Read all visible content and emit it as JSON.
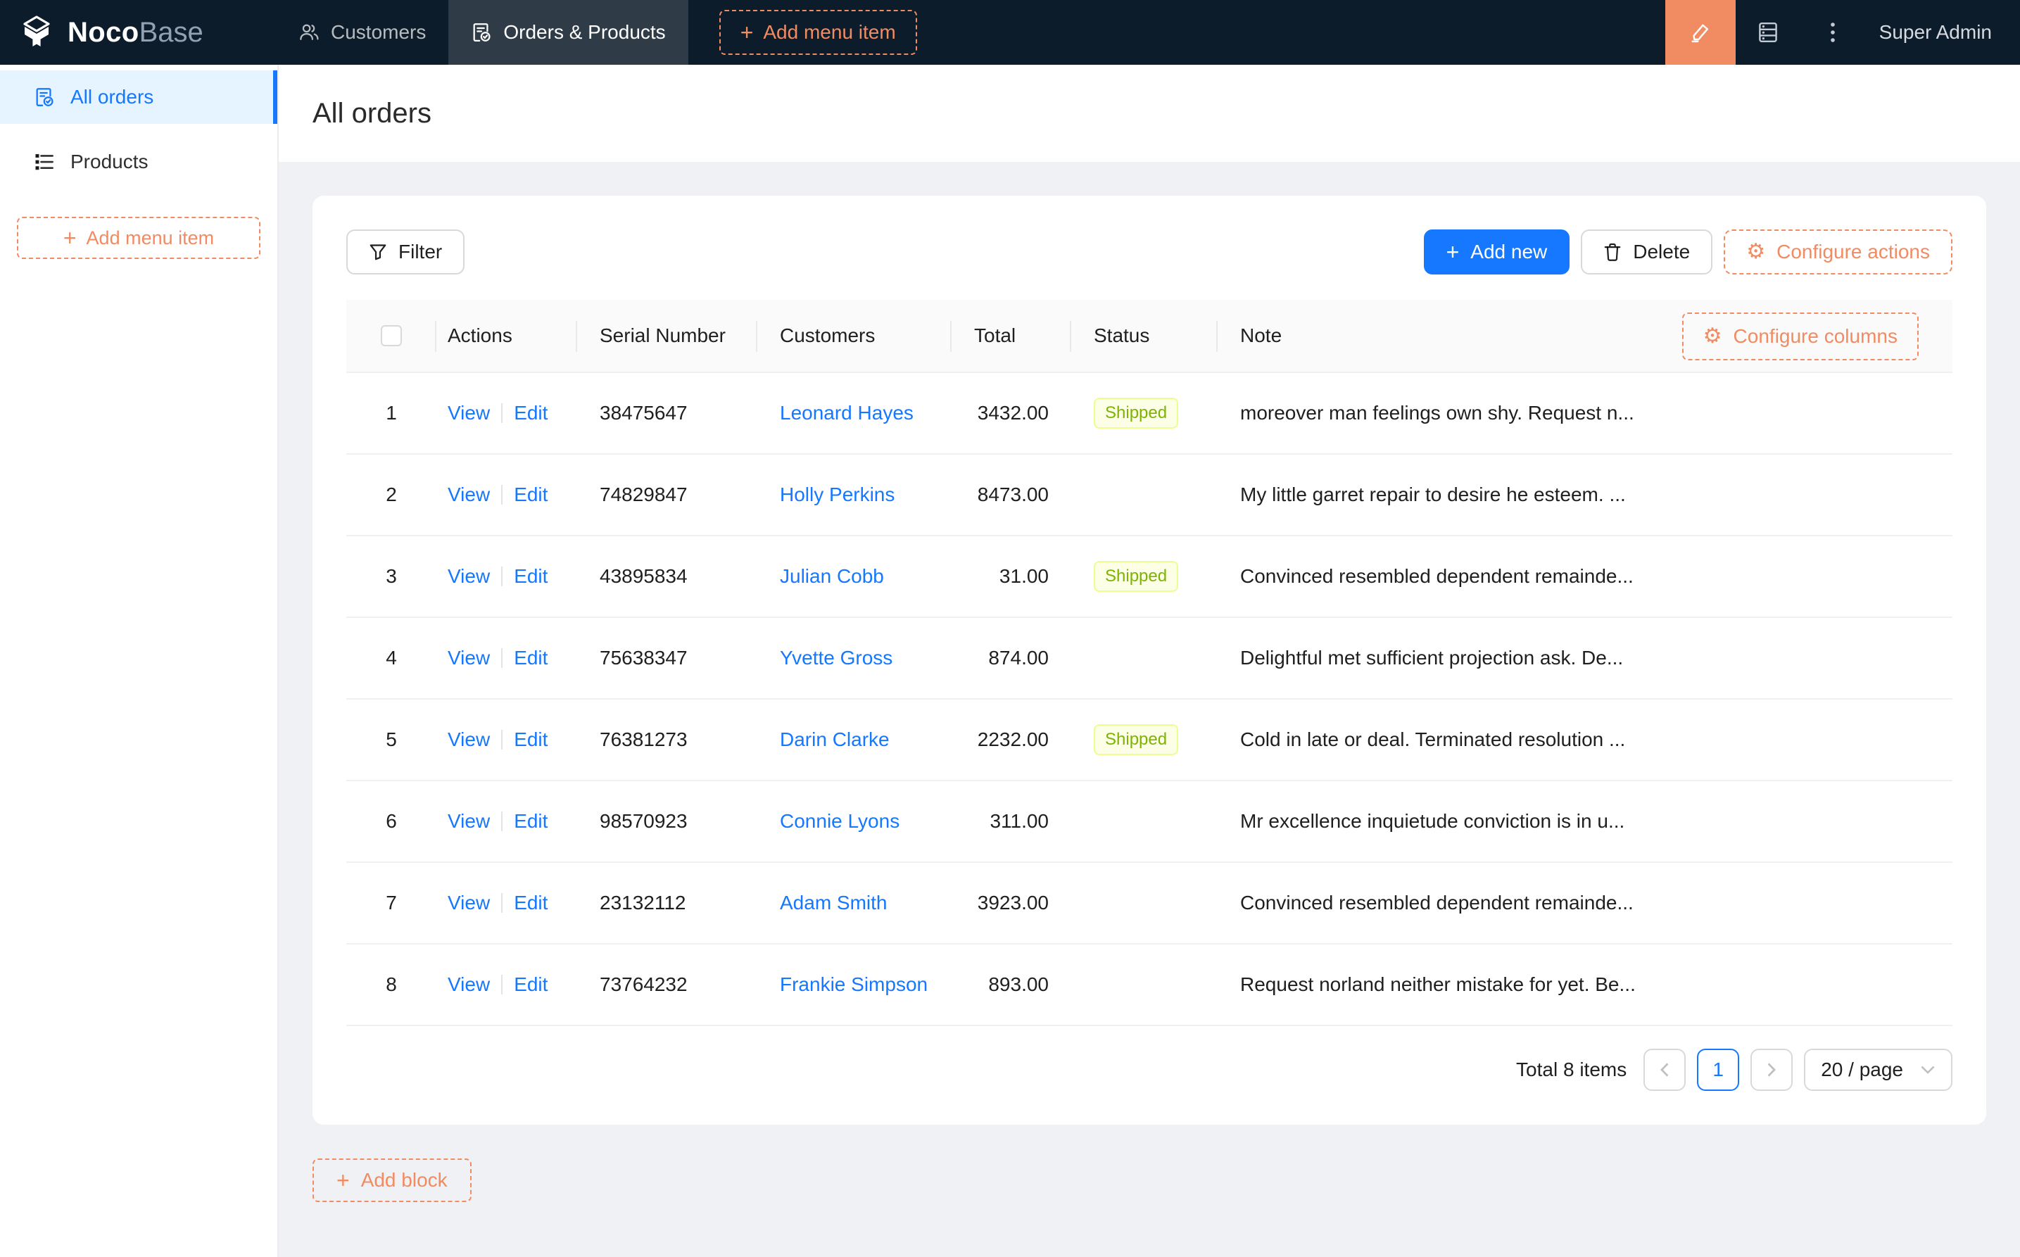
{
  "colors": {
    "header_bg": "#0d1c2b",
    "accent_orange": "#f18b62",
    "primary_blue": "#1677ff",
    "sidebar_active_bg": "#e6f4ff",
    "content_bg": "#eff1f4",
    "table_header_bg": "#fafafa",
    "tag_lime_bg": "#fcffe6",
    "tag_lime_border": "#eaff8f",
    "tag_lime_text": "#7cb305"
  },
  "topnav": {
    "logo_bold": "Noco",
    "logo_light": "Base",
    "menu": [
      {
        "label": "Customers",
        "icon": "team-icon"
      },
      {
        "label": "Orders & Products",
        "icon": "file-check-icon",
        "active": true
      }
    ],
    "add_menu_item_label": "Add menu item",
    "icons": [
      "highlighter-icon",
      "database-icon",
      "ellipsis-vertical-icon"
    ],
    "user": "Super Admin"
  },
  "sidebar": {
    "items": [
      {
        "label": "All orders",
        "icon": "file-check-icon",
        "active": true
      },
      {
        "label": "Products",
        "icon": "unordered-list-icon"
      }
    ],
    "add_menu_item_label": "Add menu item"
  },
  "page": {
    "title": "All orders"
  },
  "toolbar": {
    "filter_label": "Filter",
    "add_new_label": "Add new",
    "delete_label": "Delete",
    "configure_actions_label": "Configure actions"
  },
  "table": {
    "configure_columns_label": "Configure columns",
    "columns": [
      "Actions",
      "Serial Number",
      "Customers",
      "Total",
      "Status",
      "Note"
    ],
    "action_labels": {
      "view": "View",
      "edit": "Edit"
    },
    "rows": [
      {
        "index": "1",
        "serial": "38475647",
        "customer": "Leonard Hayes",
        "total": "3432.00",
        "status": "Shipped",
        "note": "moreover man feelings own shy. Request n..."
      },
      {
        "index": "2",
        "serial": "74829847",
        "customer": "Holly Perkins",
        "total": "8473.00",
        "status": "",
        "note": "My little garret repair to desire he esteem. ..."
      },
      {
        "index": "3",
        "serial": "43895834",
        "customer": "Julian Cobb",
        "total": "31.00",
        "status": "Shipped",
        "note": "Convinced resembled dependent remainde..."
      },
      {
        "index": "4",
        "serial": "75638347",
        "customer": "Yvette Gross",
        "total": "874.00",
        "status": "",
        "note": "Delightful met sufficient projection ask. De..."
      },
      {
        "index": "5",
        "serial": "76381273",
        "customer": "Darin Clarke",
        "total": "2232.00",
        "status": "Shipped",
        "note": "Cold in late or deal. Terminated resolution ..."
      },
      {
        "index": "6",
        "serial": "98570923",
        "customer": "Connie Lyons",
        "total": "311.00",
        "status": "",
        "note": "Mr excellence inquietude conviction is in u..."
      },
      {
        "index": "7",
        "serial": "23132112",
        "customer": "Adam Smith",
        "total": "3923.00",
        "status": "",
        "note": "Convinced resembled dependent remainde..."
      },
      {
        "index": "8",
        "serial": "73764232",
        "customer": "Frankie Simpson",
        "total": "893.00",
        "status": "",
        "note": "Request norland neither mistake for yet. Be..."
      }
    ]
  },
  "pagination": {
    "total_text": "Total 8 items",
    "current_page": "1",
    "page_size": "20 / page"
  },
  "add_block_label": "Add block"
}
